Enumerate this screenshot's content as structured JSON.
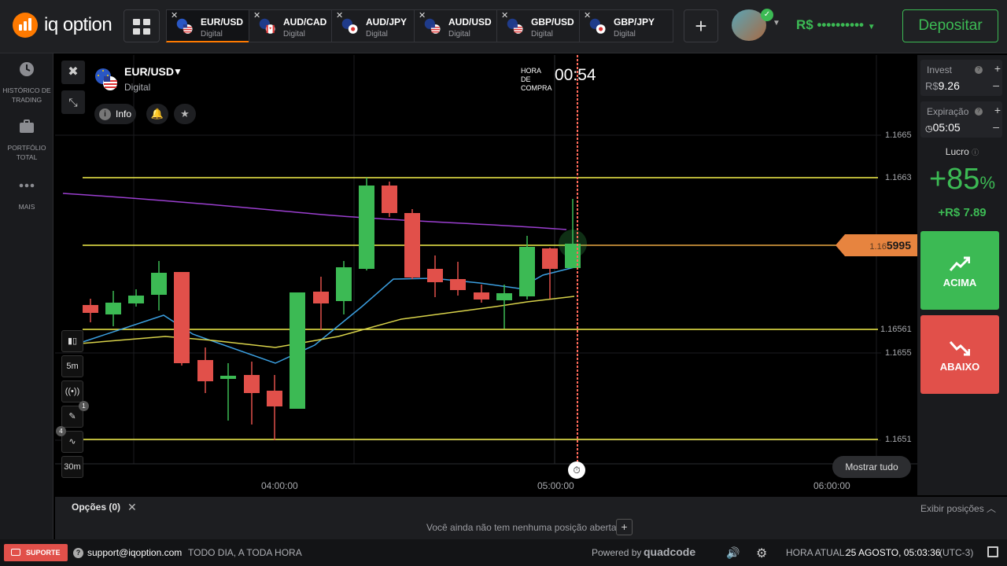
{
  "brand": {
    "name": "iq option"
  },
  "tabs": [
    {
      "name": "EUR/USD",
      "sub": "Digital",
      "active": true,
      "flag": "eu-us"
    },
    {
      "name": "AUD/CAD",
      "sub": "Digital",
      "active": false,
      "flag": "au-ca"
    },
    {
      "name": "AUD/JPY",
      "sub": "Digital",
      "active": false,
      "flag": "au-jp"
    },
    {
      "name": "AUD/USD",
      "sub": "Digital",
      "active": false,
      "flag": "au-us"
    },
    {
      "name": "GBP/USD",
      "sub": "Digital",
      "active": false,
      "flag": "gb-us"
    },
    {
      "name": "GBP/JPY",
      "sub": "Digital",
      "active": false,
      "flag": "gb-jp"
    }
  ],
  "header": {
    "balance": "R$ ••••••••••",
    "deposit_label": "Depositar"
  },
  "sidebar": {
    "items": [
      {
        "label": "HISTÓRICO DE TRADING",
        "icon": "clock-icon"
      },
      {
        "label": "PORTFÓLIO TOTAL",
        "icon": "briefcase-icon"
      },
      {
        "label": "MAIS",
        "icon": "more-icon"
      }
    ]
  },
  "asset": {
    "name": "EUR/USD",
    "type": "Digital",
    "info_label": "Info"
  },
  "purchase": {
    "label": "HORA DE COMPRA",
    "time": "00:54"
  },
  "chart": {
    "price_labels": [
      "1.1665",
      "1.1663",
      "1.16561",
      "1.1655",
      "1.1651"
    ],
    "current_price_prefix": "1.16",
    "current_price_bold": "5995",
    "time_labels": [
      "04:00:00",
      "05:00:00",
      "06:00:00"
    ],
    "candle_period": "5m",
    "timeframe": "30m",
    "tool_badges": [
      "1",
      "4"
    ],
    "show_all_label": "Mostrar tudo",
    "colors": {
      "up": "#3cba54",
      "down": "#e1504a",
      "level": "#f4f04a",
      "ma_purple": "#9b3fd0",
      "ma_blue": "#3b9fe0",
      "ma_yellow": "#d8d24a",
      "expiry": "#ff6a5a"
    }
  },
  "trade": {
    "invest_label": "Invest",
    "invest_currency": "R$",
    "invest_value": "9.26",
    "expiry_label": "Expiração",
    "expiry_value": "05:05",
    "profit_label": "Lucro",
    "profit_pct": "+85",
    "profit_pct_sign": "%",
    "profit_value": "+R$ 7.89",
    "up_label": "ACIMA",
    "down_label": "ABAIXO"
  },
  "positions": {
    "title": "Opções (0)",
    "show_label": "Exibir posições",
    "empty_text": "Você ainda não tem nenhuma posição aberta"
  },
  "status": {
    "support_label": "SUPORTE",
    "email": "support@iqoption.com",
    "availability": "TODO DIA, A TODA HORA",
    "powered_by": "Powered by",
    "powered_brand": "quadcode",
    "time_label": "HORA ATUAL:",
    "date_time": "25 AGOSTO, 05:03:36",
    "timezone": "(UTC-3)"
  }
}
